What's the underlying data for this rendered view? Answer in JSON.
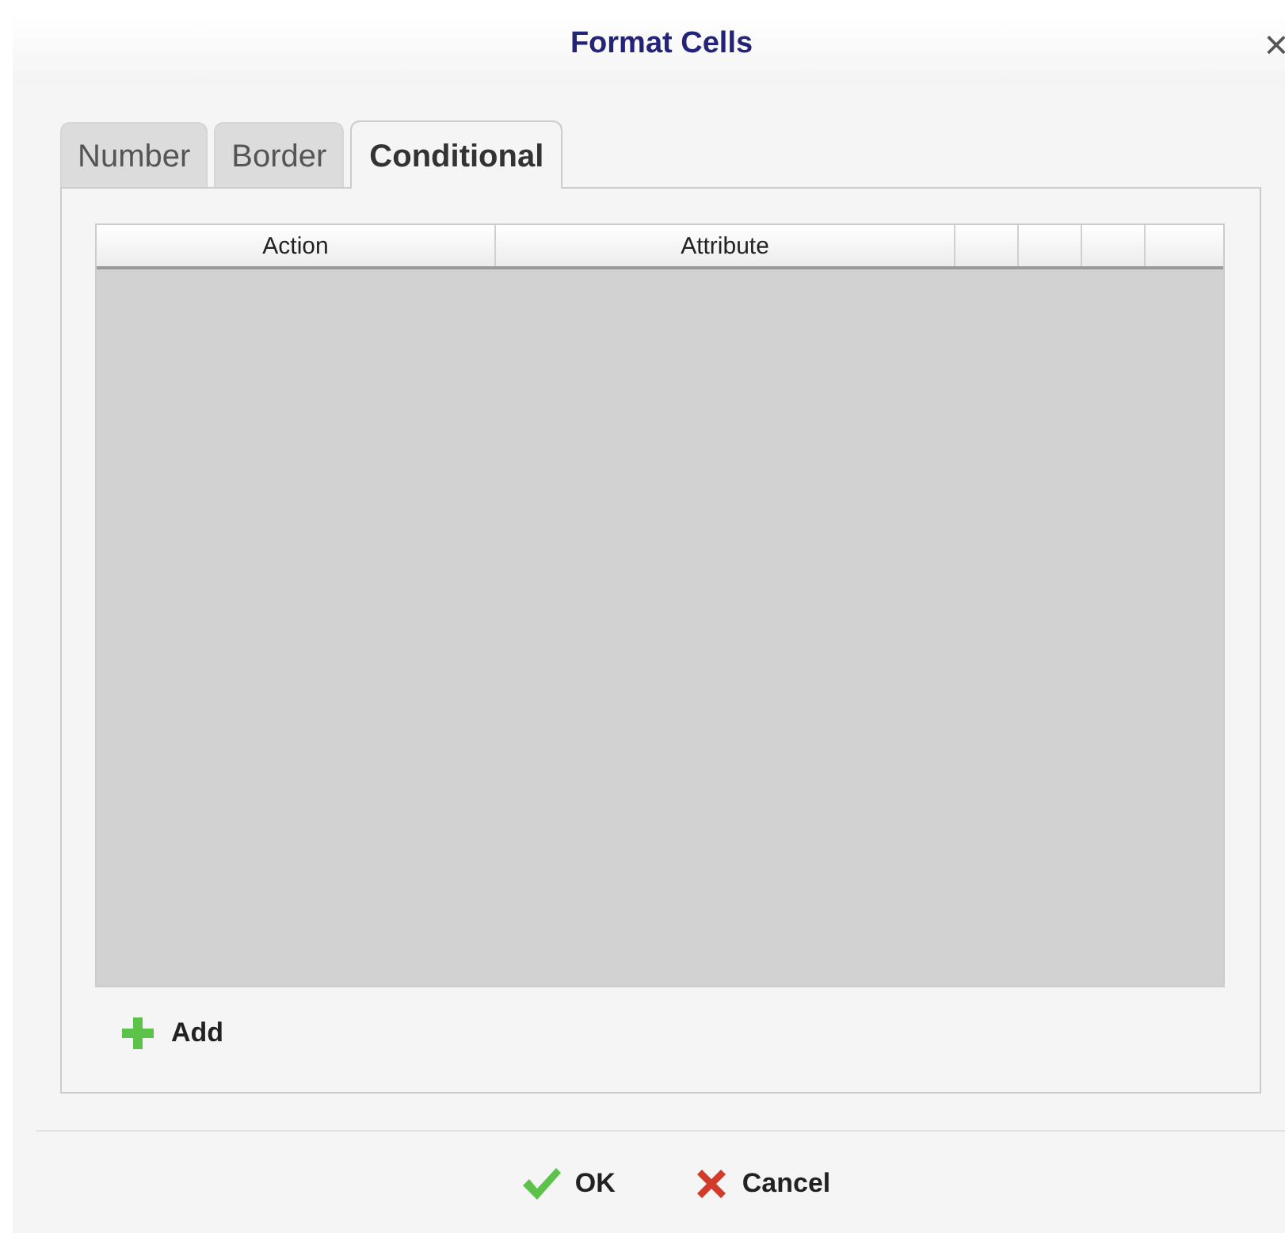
{
  "window": {
    "title": "Format Cells",
    "close": "×"
  },
  "tabs": [
    {
      "label": "Number",
      "selected": false
    },
    {
      "label": "Border",
      "selected": false
    },
    {
      "label": "Conditional",
      "selected": true
    }
  ],
  "table": {
    "columns": [
      {
        "kind": "text",
        "label": "Action"
      },
      {
        "kind": "text",
        "label": "Attribute"
      },
      {
        "kind": "blank"
      },
      {
        "kind": "blank"
      },
      {
        "kind": "blank"
      },
      {
        "kind": "blank"
      }
    ]
  },
  "add_button": {
    "label": "Add"
  },
  "buttons": [
    {
      "kind": "ok",
      "label": "OK"
    },
    {
      "kind": "cancel",
      "label": "Cancel"
    }
  ]
}
